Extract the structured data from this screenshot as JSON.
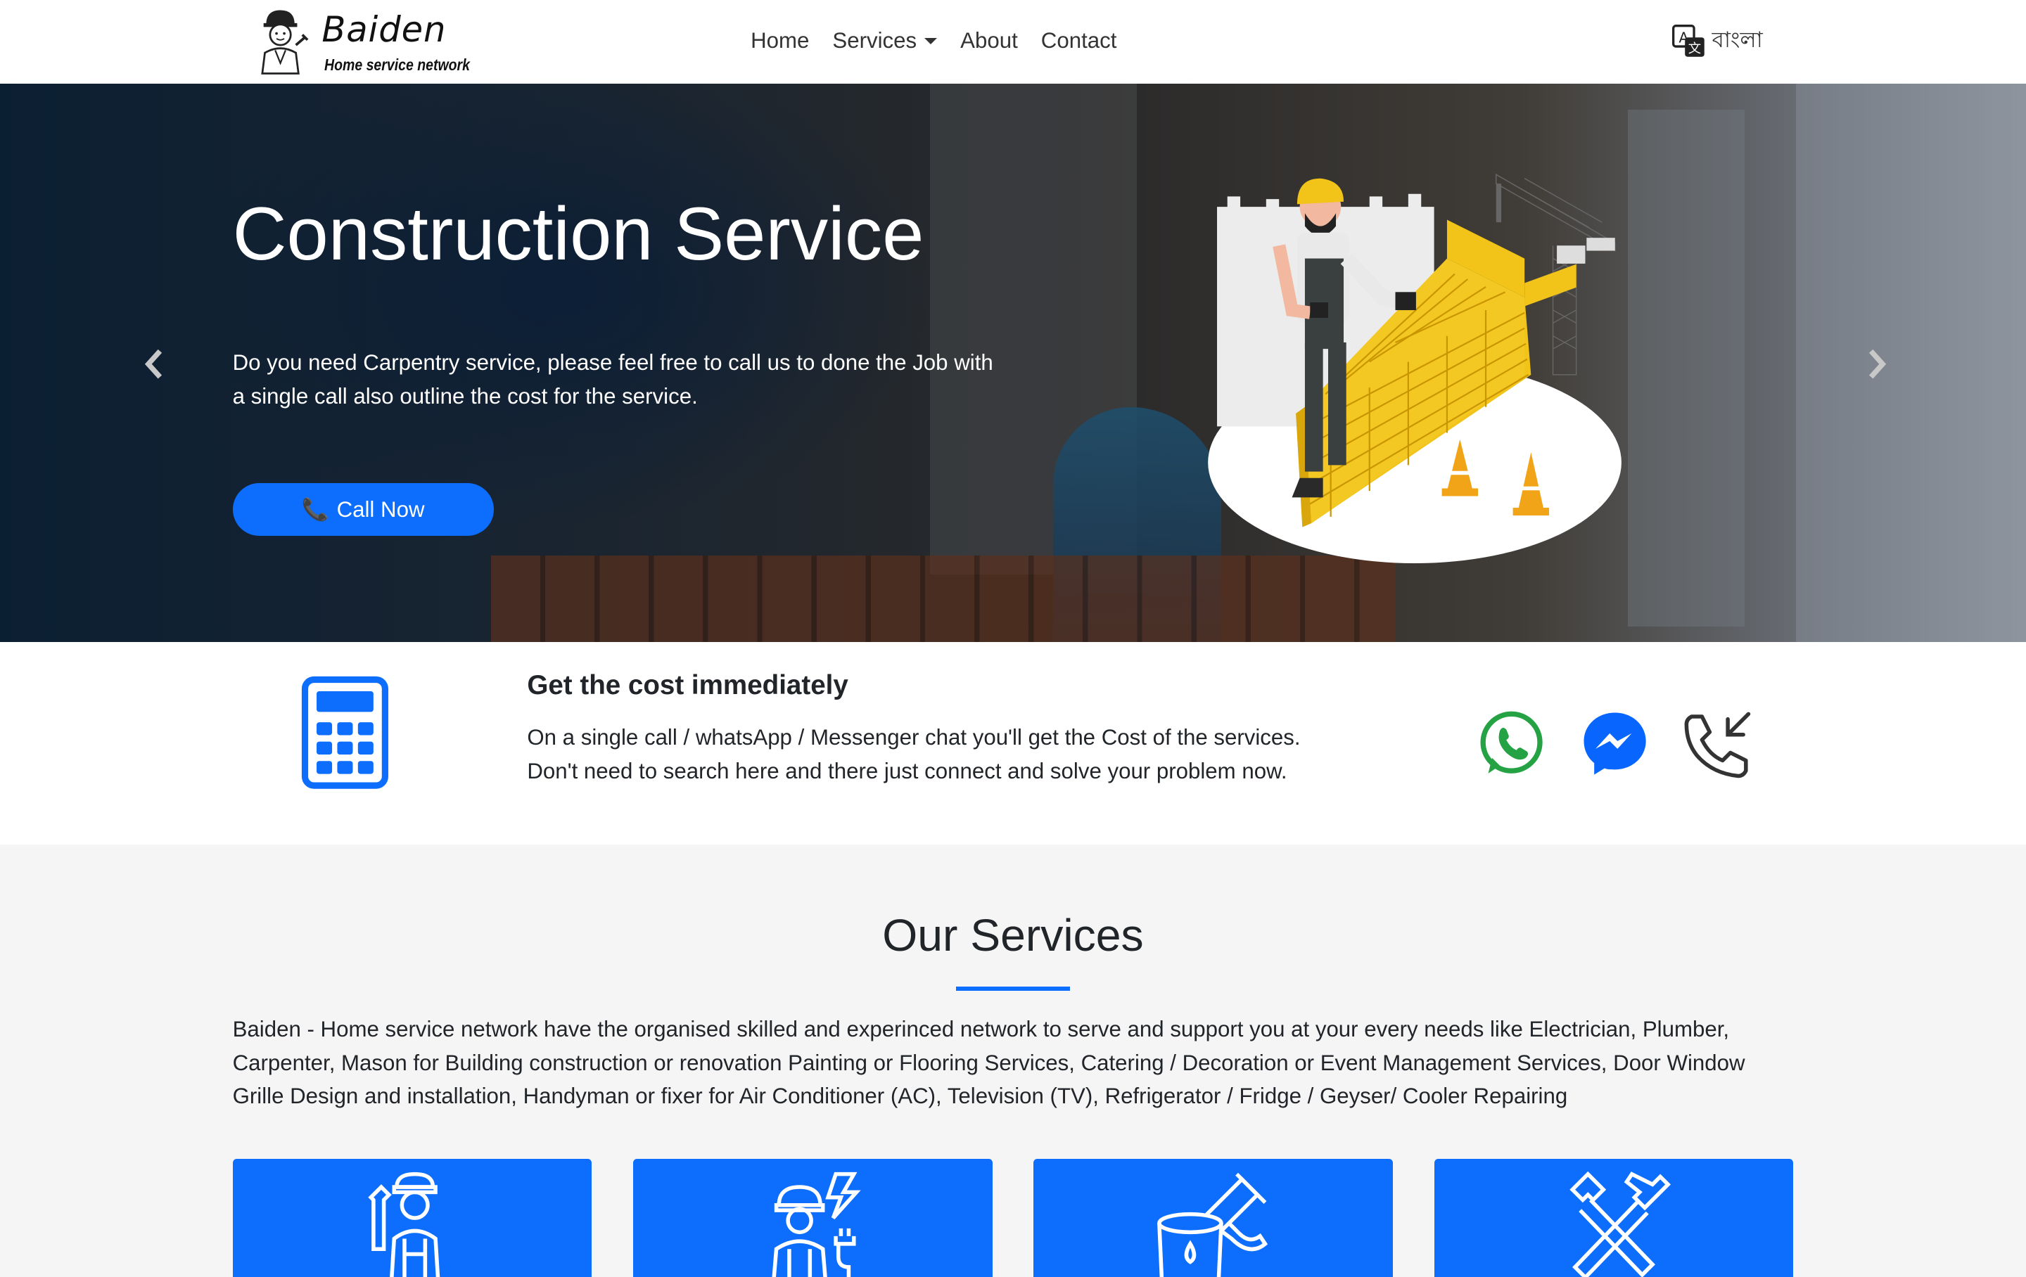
{
  "navbar": {
    "brand_name": "Baiden",
    "brand_tagline": "Home service network",
    "items": [
      {
        "label": "Home"
      },
      {
        "label": "Services"
      },
      {
        "label": "About"
      },
      {
        "label": "Contact"
      }
    ],
    "language_label": "বাংলা",
    "language_icon": "translate-icon"
  },
  "hero": {
    "title": "Construction Service",
    "description": "Do you need Carpentry service, please feel free to call us to done the Job with a single call also outline the cost for the service.",
    "cta_label": "Call Now",
    "cta_icon": "phone-icon"
  },
  "cost": {
    "title": "Get the cost immediately",
    "description": "On a single call / whatsApp / Messenger chat you'll get the Cost of the services. Don't need to search here and there just connect and solve your problem now.",
    "icons": [
      "calculator-icon",
      "whatsapp-icon",
      "messenger-icon",
      "phone-incoming-icon"
    ]
  },
  "services": {
    "title": "Our Services",
    "description": "Baiden - Home service network have the organised skilled and experinced network to serve and support you at your every needs like Electrician, Plumber, Carpenter, Mason for Building construction or renovation Painting or Flooring Services, Catering / Decoration or Event Management Services, Door Window Grille Design and installation, Handyman or fixer for Air Conditioner (AC), Television (TV), Refrigerator / Fridge / Geyser/ Cooler Repairing",
    "cards": [
      "plumber-icon",
      "electrician-icon",
      "painter-icon",
      "handyman-tools-icon"
    ]
  },
  "colors": {
    "primary": "#0d6efd",
    "whatsapp": "#25a244",
    "messenger": "#0866ff",
    "services_bg": "#f5f5f5"
  }
}
